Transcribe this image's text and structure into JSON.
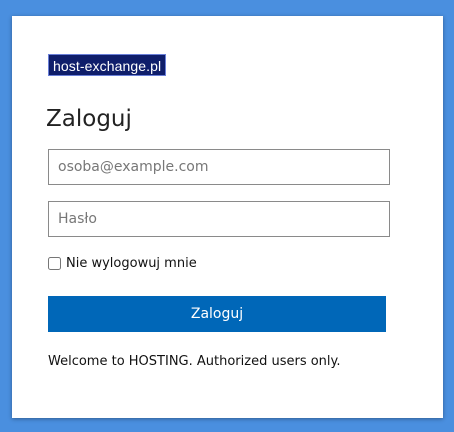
{
  "colors": {
    "background": "#4a8fdf",
    "card": "#ffffff",
    "logo_bg": "#0f1e6b",
    "primary_button": "#0067b8"
  },
  "logo": {
    "text": "host-exchange.pl"
  },
  "title": "Zaloguj",
  "form": {
    "email": {
      "placeholder": "osoba@example.com",
      "value": ""
    },
    "password": {
      "placeholder": "Hasło",
      "value": ""
    },
    "remember": {
      "label": "Nie wylogowuj mnie",
      "checked": false
    },
    "submit_label": "Zaloguj"
  },
  "notice": "Welcome to HOSTING. Authorized users only."
}
